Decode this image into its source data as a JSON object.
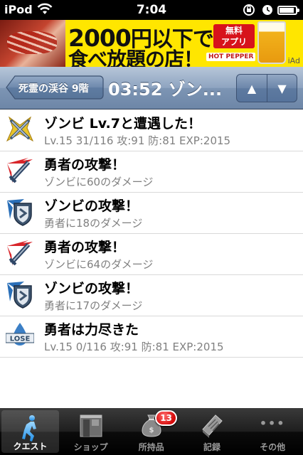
{
  "status": {
    "carrier": "iPod",
    "time": "7:04",
    "battery_level": 0.92
  },
  "ad": {
    "line1_price": "2000",
    "line1_rest": "円以下で",
    "line2": "食べ放題の店！",
    "badge_line1": "無料",
    "badge_line2": "アプリ",
    "brand": "HOT PEPPER",
    "iad": "iAd"
  },
  "nav": {
    "back_label": "死霊の渓谷 9階",
    "title": "03:52 ゾン...",
    "up_icon": "▲",
    "down_icon": "▼"
  },
  "log": [
    {
      "icon": "crossed-swords-icon",
      "title": "ゾンビ Lv.7と遭遇した！",
      "sub": "Lv.15 31/116 攻:91 防:81 EXP:2015"
    },
    {
      "icon": "sword-attack-icon",
      "title": "勇者の攻撃！",
      "sub": "ゾンビに60のダメージ"
    },
    {
      "icon": "shield-icon",
      "title": "ゾンビの攻撃！",
      "sub": "勇者に18のダメージ"
    },
    {
      "icon": "sword-attack-icon",
      "title": "勇者の攻撃！",
      "sub": "ゾンビに64のダメージ"
    },
    {
      "icon": "shield-icon",
      "title": "ゾンビの攻撃！",
      "sub": "勇者に17のダメージ"
    },
    {
      "icon": "lose-icon",
      "title": "勇者は力尽きた",
      "sub": "Lv.15 0/116 攻:91 防:81 EXP:2015",
      "icon_text": "LOSE"
    }
  ],
  "tabs": [
    {
      "label": "クエスト",
      "icon": "runner-icon",
      "selected": true
    },
    {
      "label": "ショップ",
      "icon": "shop-icon"
    },
    {
      "label": "所持品",
      "icon": "money-bag-icon",
      "badge": "13"
    },
    {
      "label": "記録",
      "icon": "book-icon"
    },
    {
      "label": "その他",
      "icon": "more-icon",
      "icon_text": "•••"
    }
  ]
}
